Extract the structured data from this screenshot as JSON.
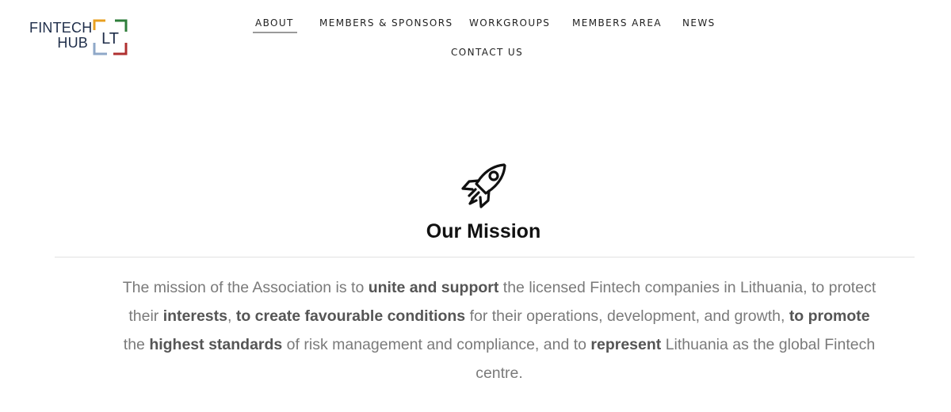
{
  "logo": {
    "line1": "FINTECH",
    "line2": "HUB",
    "mark": "LT",
    "colors": {
      "text": "#1f2e4a",
      "orange": "#e8a020",
      "green": "#2e7d3a",
      "blue": "#8fa8c8",
      "red": "#b03030"
    }
  },
  "nav": {
    "items": [
      {
        "label": "ABOUT",
        "active": true
      },
      {
        "label": "MEMBERS & SPONSORS"
      },
      {
        "label": "WORKGROUPS"
      },
      {
        "label": "MEMBERS AREA"
      },
      {
        "label": "NEWS"
      },
      {
        "label": "CONTACT US"
      }
    ]
  },
  "mission": {
    "icon": "rocket-icon",
    "title": "Our Mission",
    "segments": [
      {
        "text": "The mission of the Association is to ",
        "bold": false
      },
      {
        "text": "unite and support",
        "bold": true
      },
      {
        "text": " the licensed Fintech companies in Lithuania, to protect their ",
        "bold": false
      },
      {
        "text": "interests",
        "bold": true
      },
      {
        "text": ", ",
        "bold": false
      },
      {
        "text": "to create favourable conditions",
        "bold": true
      },
      {
        "text": " for their operations, development, and growth, ",
        "bold": false
      },
      {
        "text": "to promote",
        "bold": true
      },
      {
        "text": " the ",
        "bold": false
      },
      {
        "text": "highest standards",
        "bold": true
      },
      {
        "text": " of risk management and compliance, and to ",
        "bold": false
      },
      {
        "text": "represent",
        "bold": true
      },
      {
        "text": " Lithuania as the global Fintech centre.",
        "bold": false
      }
    ]
  }
}
